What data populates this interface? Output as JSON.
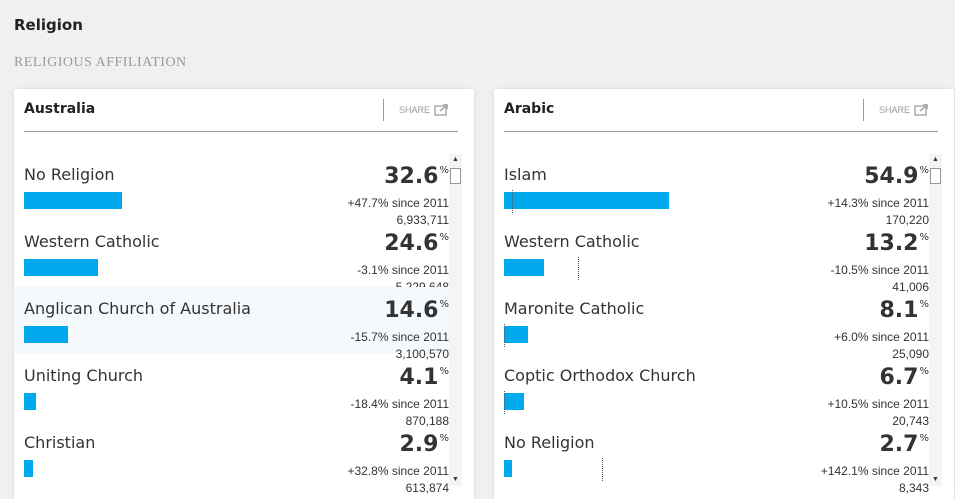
{
  "page": {
    "title": "Religion",
    "section": "RELIGIOUS AFFILIATION"
  },
  "share_label": "SHARE",
  "colors": {
    "bar": "#00a9ec",
    "background": "#f1f0ee"
  },
  "panels": [
    {
      "title": "Australia",
      "items": [
        {
          "name": "No Religion",
          "percent": "32.6",
          "change": "+47.7% since 2011",
          "count": "6,933,711"
        },
        {
          "name": "Western Catholic",
          "percent": "24.6",
          "change": "-3.1% since 2011",
          "count": "5,229,648"
        },
        {
          "name": "Anglican Church of Australia",
          "percent": "14.6",
          "change": "-15.7% since 2011",
          "count": "3,100,570"
        },
        {
          "name": "Uniting Church",
          "percent": "4.1",
          "change": "-18.4% since 2011",
          "count": "870,188"
        },
        {
          "name": "Christian",
          "percent": "2.9",
          "change": "+32.8% since 2011",
          "count": "613,874"
        }
      ]
    },
    {
      "title": "Arabic",
      "items": [
        {
          "name": "Islam",
          "percent": "54.9",
          "change": "+14.3% since 2011",
          "count": "170,220"
        },
        {
          "name": "Western Catholic",
          "percent": "13.2",
          "change": "-10.5% since 2011",
          "count": "41,006"
        },
        {
          "name": "Maronite Catholic",
          "percent": "8.1",
          "change": "+6.0% since 2011",
          "count": "25,090"
        },
        {
          "name": "Coptic Orthodox Church",
          "percent": "6.7",
          "change": "+10.5% since 2011",
          "count": "20,743"
        },
        {
          "name": "No Religion",
          "percent": "2.7",
          "change": "+142.1% since 2011",
          "count": "8,343"
        }
      ]
    }
  ]
}
